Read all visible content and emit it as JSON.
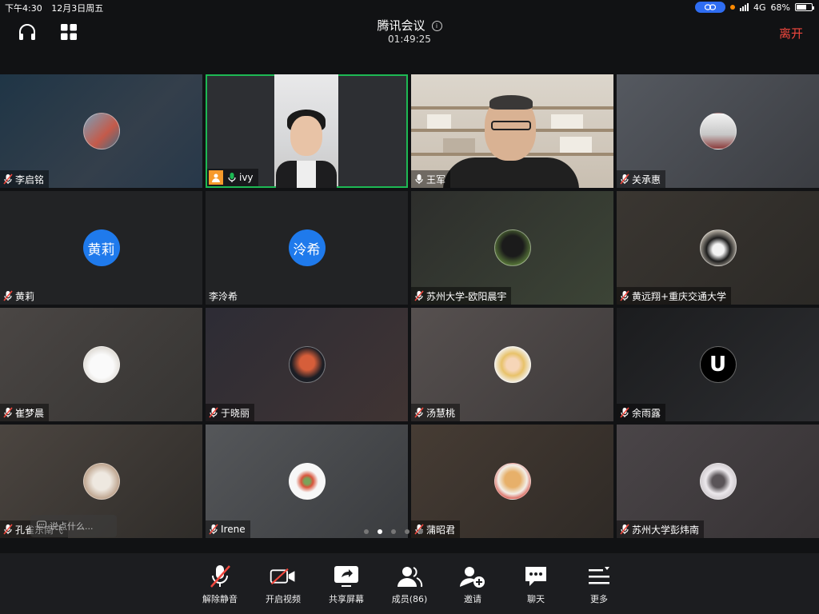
{
  "status": {
    "time": "下午4:30",
    "date": "12月3日周五",
    "network": "4G",
    "battery": "68%",
    "battery_level": 0.68
  },
  "header": {
    "title": "腾讯会议",
    "timer": "01:49:25",
    "leave_label": "离开"
  },
  "participants": [
    {
      "name": "李启铭",
      "muted": true,
      "kind": "avatar"
    },
    {
      "name": "ivy",
      "muted": false,
      "kind": "video",
      "host": true,
      "active_speaker": true
    },
    {
      "name": "王军",
      "muted": false,
      "kind": "video"
    },
    {
      "name": "关承惠",
      "muted": true,
      "kind": "avatar"
    },
    {
      "name": "黄莉",
      "muted": true,
      "kind": "initials",
      "initials": "黄莉"
    },
    {
      "name": "李泠希",
      "muted": false,
      "kind": "initials",
      "initials": "泠希"
    },
    {
      "name": "苏州大学-欧阳晨宇",
      "muted": true,
      "kind": "avatar"
    },
    {
      "name": "黄远翔+重庆交通大学",
      "muted": true,
      "kind": "avatar"
    },
    {
      "name": "崔梦晨",
      "muted": true,
      "kind": "avatar"
    },
    {
      "name": "于晓丽",
      "muted": true,
      "kind": "avatar"
    },
    {
      "name": "汤慧桃",
      "muted": true,
      "kind": "avatar"
    },
    {
      "name": "余雨露",
      "muted": true,
      "kind": "letter",
      "initials": "U"
    },
    {
      "name": "孔雀东南飞",
      "muted": true,
      "kind": "avatar"
    },
    {
      "name": "Irene",
      "muted": true,
      "kind": "avatar"
    },
    {
      "name": "蒲昭君",
      "muted": true,
      "kind": "avatar"
    },
    {
      "name": "苏州大学彭炜南",
      "muted": true,
      "kind": "avatar"
    }
  ],
  "chat_hint": "说点什么...",
  "pagination": {
    "pages": 5,
    "current": 2
  },
  "toolbar": {
    "unmute": "解除静音",
    "start_video": "开启视频",
    "share_screen": "共享屏幕",
    "members": "成员(86)",
    "invite": "邀请",
    "chat": "聊天",
    "more": "更多"
  },
  "colors": {
    "leave": "#f0473d",
    "active_speaker_border": "#1db954",
    "initials_avatar": "#1f7aec",
    "host_badge": "#f79a2b"
  }
}
